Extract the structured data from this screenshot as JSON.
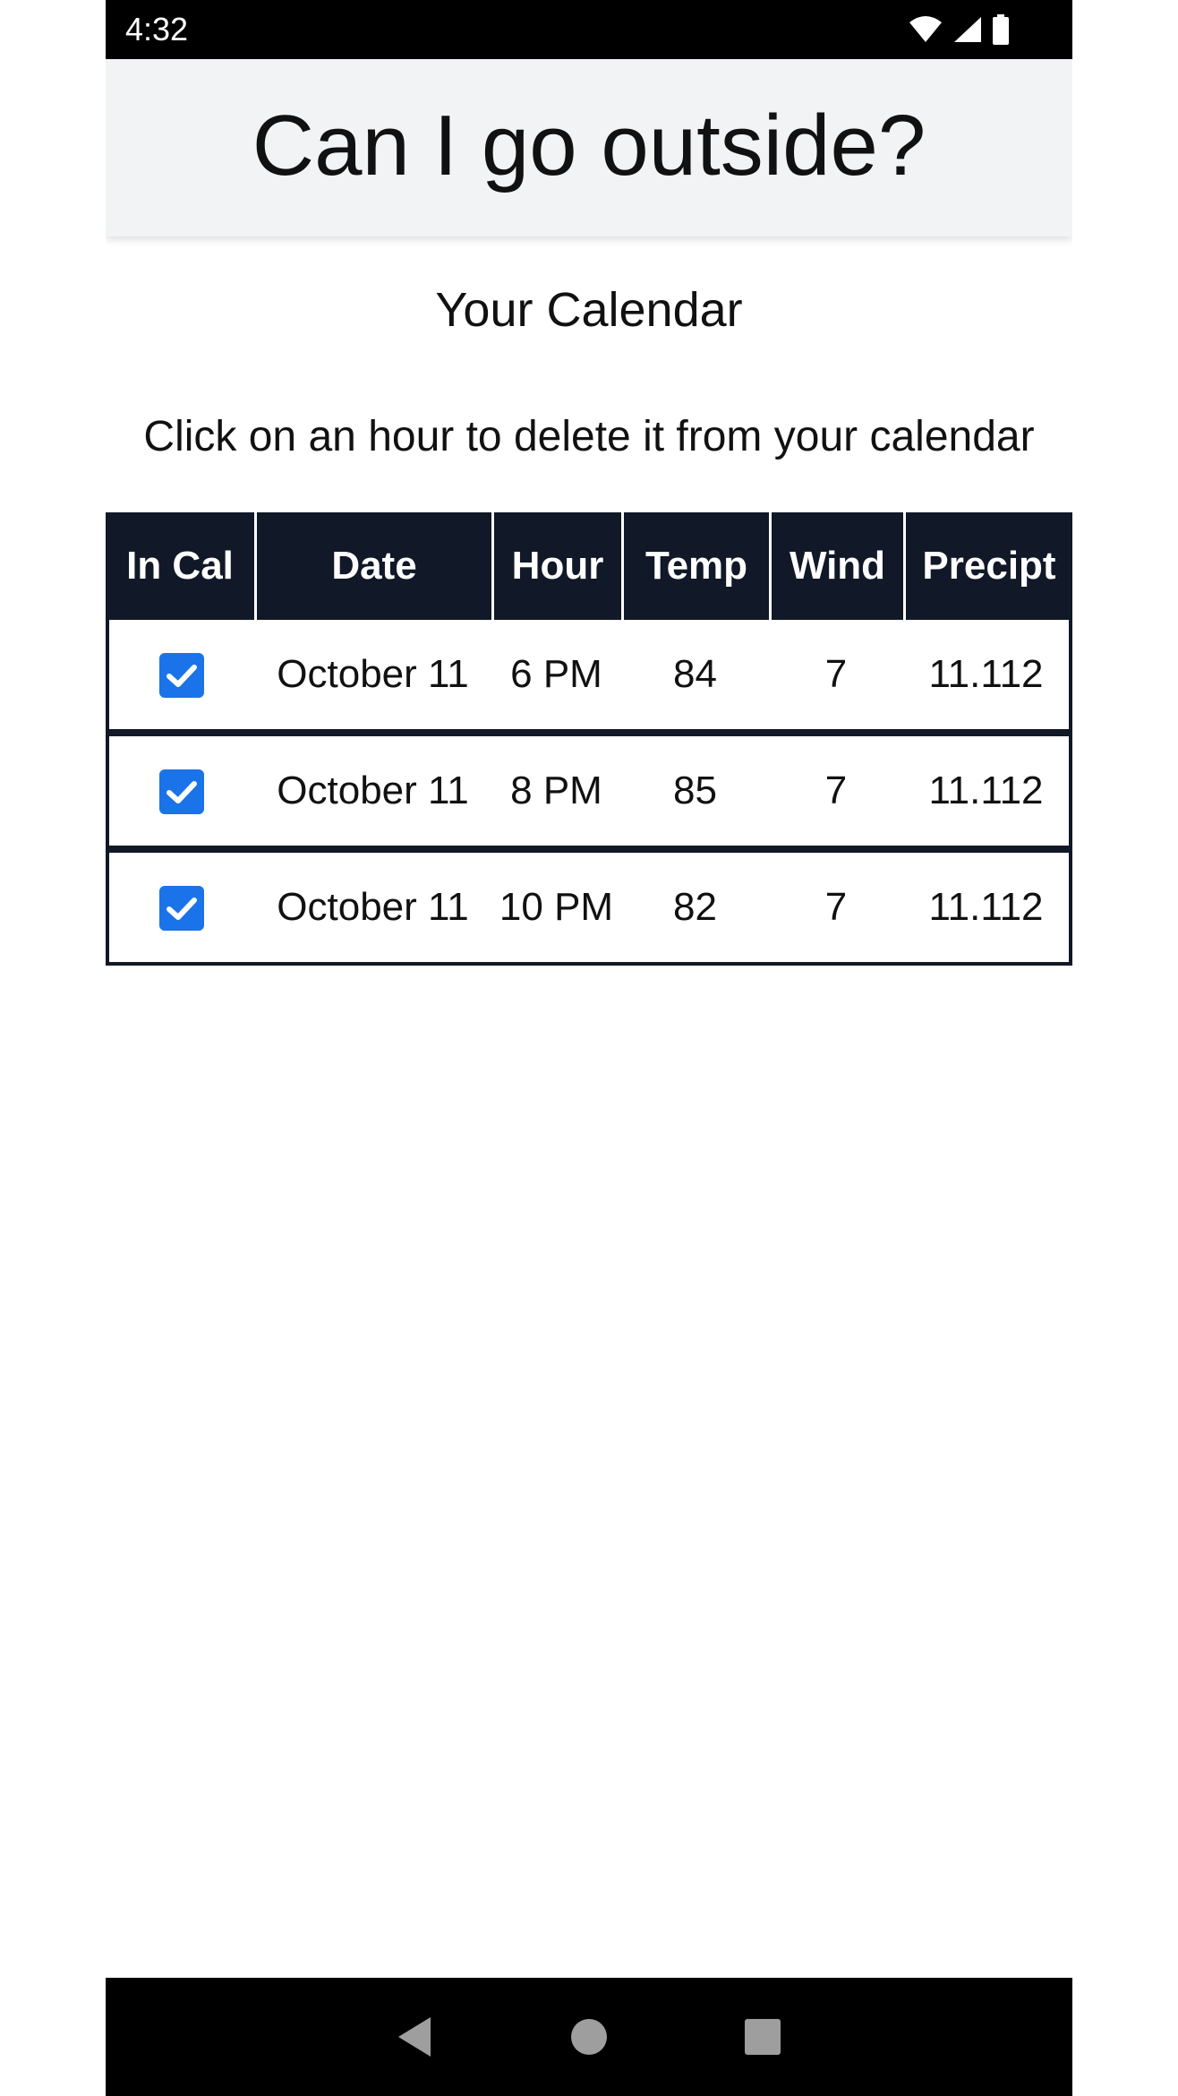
{
  "status_bar": {
    "time": "4:32",
    "icons": [
      "wifi-icon",
      "cell-signal-icon",
      "battery-icon"
    ]
  },
  "header": {
    "title": "Can I go outside?"
  },
  "calendar": {
    "title": "Your Calendar",
    "instructions": "Click on an hour to delete it from your calendar",
    "columns": [
      "In Cal",
      "Date",
      "Hour",
      "Temp",
      "Wind",
      "Precipt"
    ],
    "rows": [
      {
        "in_cal": true,
        "date": "October 11",
        "hour": "6 PM",
        "temp": "84",
        "wind": "7",
        "precip": "11.112"
      },
      {
        "in_cal": true,
        "date": "October 11",
        "hour": "8 PM",
        "temp": "85",
        "wind": "7",
        "precip": "11.112"
      },
      {
        "in_cal": true,
        "date": "October 11",
        "hour": "10 PM",
        "temp": "82",
        "wind": "7",
        "precip": "11.112"
      }
    ]
  },
  "nav_bar": {
    "buttons": [
      "back-icon",
      "home-icon",
      "recents-icon"
    ]
  },
  "colors": {
    "header_bg": "#f2f3f5",
    "table_header_bg": "#111827",
    "checkbox": "#1a73e8",
    "system_bar": "#000000"
  }
}
